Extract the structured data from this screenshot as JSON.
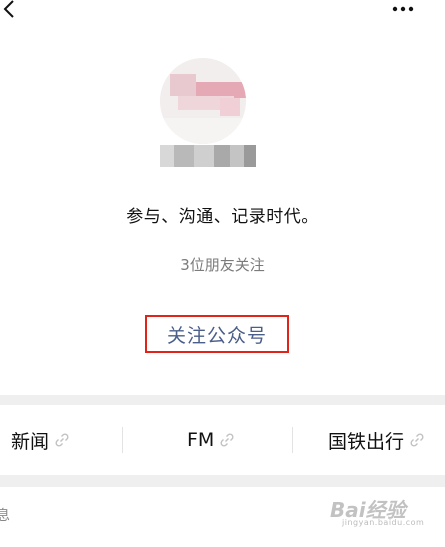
{
  "profile": {
    "description": "参与、沟通、记录时代。",
    "friends_following": "3位朋友关注",
    "follow_label": "关注公众号"
  },
  "menu": {
    "items": [
      {
        "label": "新闻",
        "icon": "link-icon"
      },
      {
        "label": "FM",
        "icon": "link-icon"
      },
      {
        "label": "国铁出行",
        "icon": "link-icon"
      }
    ]
  },
  "tabs": {
    "partial_label": "息"
  },
  "icons": {
    "back": "chevron-left-icon",
    "more": "more-dots-icon"
  },
  "colors": {
    "highlight_box": "#e2231a",
    "link_text": "#4a5e8a"
  },
  "watermark": {
    "brand": "Bai经验",
    "url": "jingyan.baidu.com"
  }
}
